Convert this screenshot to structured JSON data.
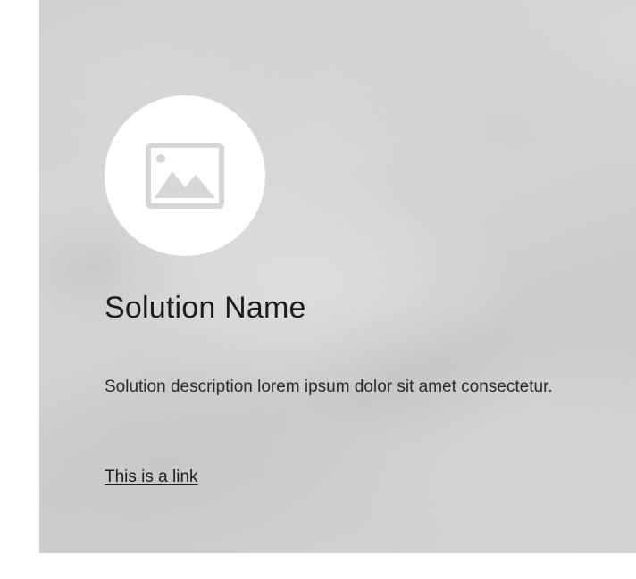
{
  "card": {
    "image_icon": "image-placeholder-icon",
    "title": "Solution Name",
    "description": "Solution description lorem ipsum dolor sit amet consectetur.",
    "link_text": "This is a link"
  },
  "colors": {
    "background": "#ffffff",
    "card_background": "#d3d3d3",
    "icon_circle": "#ffffff",
    "icon": "#d6d6d6",
    "text": "#1c1c1c"
  }
}
